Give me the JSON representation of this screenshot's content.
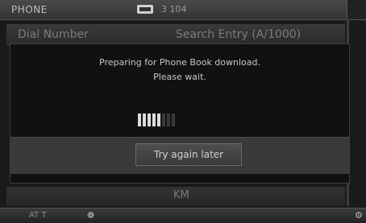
{
  "status": {
    "title": "PHONE",
    "phone_icon": "phone-icon",
    "info": "3 104"
  },
  "background": {
    "dial_number": "Dial Number",
    "search_entry": "Search Entry (A/1000)",
    "km": "KM"
  },
  "dialog": {
    "line1": "Preparing for Phone Book download.",
    "line2": "Please wait.",
    "progress": {
      "filled": 5,
      "total": 8
    },
    "button_label": "Try again later"
  },
  "bottom": {
    "temp": "AT T",
    "bluetooth_icon": "bluetooth-icon",
    "corner_icon": "settings-icon"
  },
  "colors": {
    "background": "#1a1a1a",
    "dialog": "#111111",
    "text": "#c8c8c8"
  }
}
